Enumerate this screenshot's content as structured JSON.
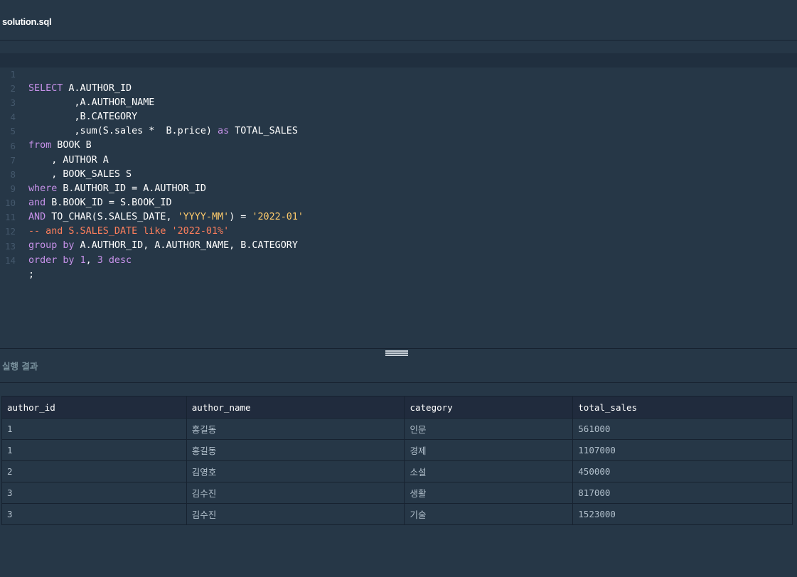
{
  "editor": {
    "file_name": "solution.sql",
    "line_numbers": [
      "1",
      "2",
      "3",
      "4",
      "5",
      "6",
      "7",
      "8",
      "9",
      "10",
      "11",
      "12",
      "13",
      "14"
    ]
  },
  "code": {
    "l1": {
      "kw1": "SELECT",
      "t1": " A.AUTHOR_ID"
    },
    "l2": {
      "t1": "        ,A.AUTHOR_NAME"
    },
    "l3": {
      "t1": "        ,B.CATEGORY"
    },
    "l4": {
      "t1": "        ,sum(S.sales *  B.price) ",
      "kw1": "as",
      "t2": " TOTAL_SALES"
    },
    "l5": {
      "kw1": "from",
      "t1": " BOOK B"
    },
    "l6": {
      "t1": "    , AUTHOR A"
    },
    "l7": {
      "t1": "    , BOOK_SALES S"
    },
    "l8": {
      "kw1": "where",
      "t1": " B.AUTHOR_ID = A.AUTHOR_ID"
    },
    "l9": {
      "kw1": "and",
      "t1": " B.BOOK_ID = S.BOOK_ID"
    },
    "l10": {
      "kw1": "AND",
      "t1": " TO_CHAR(S.SALES_DATE, ",
      "s1": "'YYYY-MM'",
      "t2": ") = ",
      "s2": "'2022-01'"
    },
    "l11": {
      "c1": "-- and S.SALES_DATE like '2022-01%'"
    },
    "l12": {
      "kw1": "group by",
      "t1": " A.AUTHOR_ID, A.AUTHOR_NAME, B.CATEGORY"
    },
    "l13": {
      "kw1": "order by",
      "t1": " ",
      "n1": "1",
      "t2": ", ",
      "n2": "3",
      "t3": " ",
      "kw2": "desc"
    },
    "l14": {
      "t1": ";"
    }
  },
  "results": {
    "title": "실행 결과",
    "columns": [
      "author_id",
      "author_name",
      "category",
      "total_sales"
    ],
    "rows": [
      [
        "1",
        "홍길동",
        "인문",
        "561000"
      ],
      [
        "1",
        "홍길동",
        "경제",
        "1107000"
      ],
      [
        "2",
        "김영호",
        "소설",
        "450000"
      ],
      [
        "3",
        "김수진",
        "생활",
        "817000"
      ],
      [
        "3",
        "김수진",
        "기술",
        "1523000"
      ]
    ]
  },
  "colors": {
    "background": "#263747",
    "keyword": "#c792ea",
    "string": "#ffcb6b",
    "comment": "#ff7f5c",
    "line_number": "#44586c"
  }
}
